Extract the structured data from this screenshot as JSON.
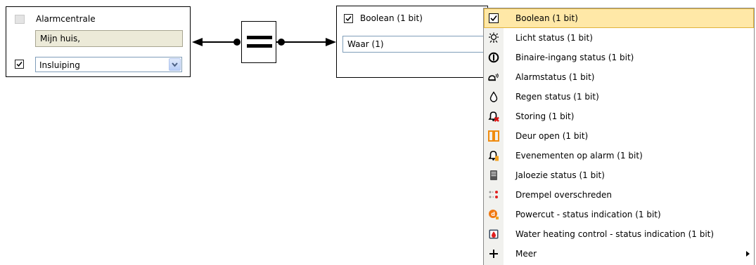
{
  "left_block": {
    "title": "Alarmcentrale",
    "value": "Mijn huis,",
    "combo_value": "Insluiping",
    "icon": "gray-square-icon"
  },
  "right_block": {
    "title": "Boolean (1 bit)",
    "value": "Waar (1)"
  },
  "connector": {
    "operator_symbol": "="
  },
  "menu": {
    "items": [
      {
        "label": "Boolean (1 bit)",
        "icon": "checkbox-icon",
        "selected": true
      },
      {
        "label": "Licht status (1 bit)",
        "icon": "light-icon"
      },
      {
        "label": "Binaire-ingang status (1 bit)",
        "icon": "power-icon"
      },
      {
        "label": "Alarmstatus (1 bit)",
        "icon": "alarm-icon"
      },
      {
        "label": "Regen status (1 bit)",
        "icon": "rain-drop-icon"
      },
      {
        "label": "Storing (1 bit)",
        "icon": "bell-error-icon"
      },
      {
        "label": "Deur open (1 bit)",
        "icon": "door-icon"
      },
      {
        "label": "Evenementen op alarm (1 bit)",
        "icon": "bell-warning-icon"
      },
      {
        "label": "Jaloezie status (1 bit)",
        "icon": "blinds-icon"
      },
      {
        "label": "Drempel overschreden",
        "icon": "threshold-icon"
      },
      {
        "label": "Powercut - status indication (1 bit)",
        "icon": "powercut-icon"
      },
      {
        "label": "Water heating control - status indication (1 bit)",
        "icon": "water-heater-icon"
      },
      {
        "label": "Meer",
        "icon": "plus-icon",
        "has_submenu": true
      }
    ]
  },
  "colors": {
    "selection_bg": "#ffe8a7",
    "readonly_field_bg": "#ecead8",
    "menu_strip": "#f1f1ee"
  }
}
